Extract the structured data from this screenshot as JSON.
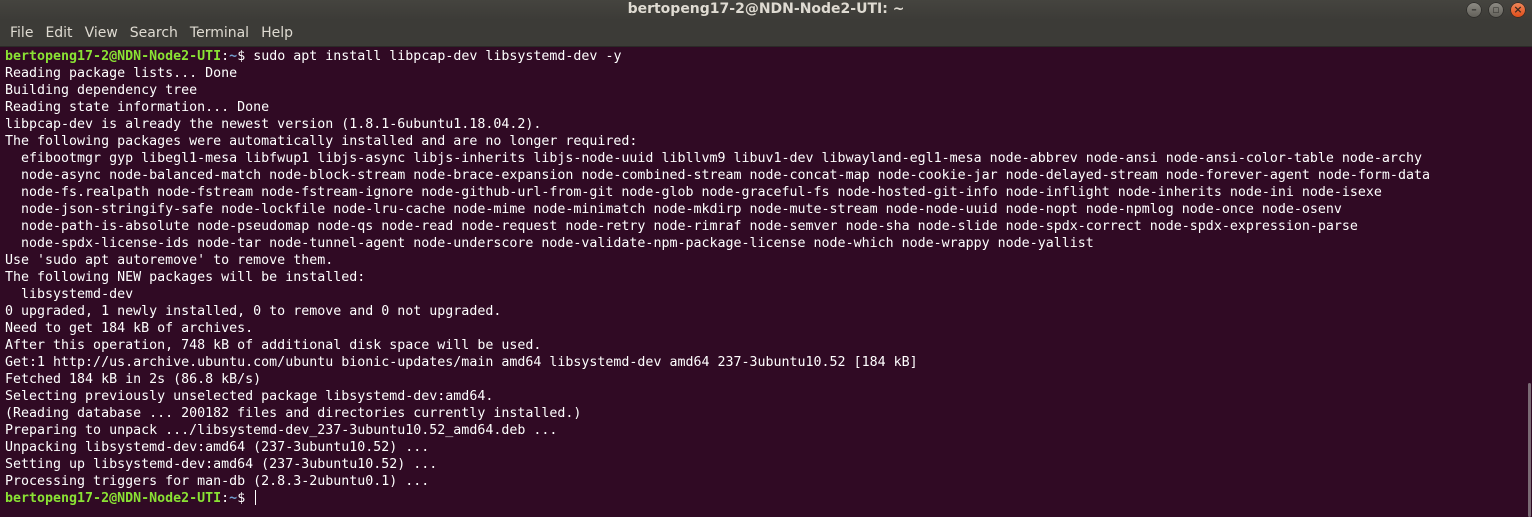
{
  "window": {
    "title": "bertopeng17-2@NDN-Node2-UTI: ~",
    "buttons": {
      "minimize": "–",
      "maximize": "▫",
      "close": "×"
    }
  },
  "menu": [
    "File",
    "Edit",
    "View",
    "Search",
    "Terminal",
    "Help"
  ],
  "prompt": {
    "user_host": "bertopeng17-2@NDN-Node2-UTI",
    "colon": ":",
    "path": "~",
    "symbol": "$ "
  },
  "command": "sudo apt install libpcap-dev libsystemd-dev -y",
  "output": [
    "Reading package lists... Done",
    "Building dependency tree",
    "Reading state information... Done",
    "libpcap-dev is already the newest version (1.8.1-6ubuntu1.18.04.2).",
    "The following packages were automatically installed and are no longer required:",
    "  efibootmgr gyp libegl1-mesa libfwup1 libjs-async libjs-inherits libjs-node-uuid libllvm9 libuv1-dev libwayland-egl1-mesa node-abbrev node-ansi node-ansi-color-table node-archy",
    "  node-async node-balanced-match node-block-stream node-brace-expansion node-combined-stream node-concat-map node-cookie-jar node-delayed-stream node-forever-agent node-form-data",
    "  node-fs.realpath node-fstream node-fstream-ignore node-github-url-from-git node-glob node-graceful-fs node-hosted-git-info node-inflight node-inherits node-ini node-isexe",
    "  node-json-stringify-safe node-lockfile node-lru-cache node-mime node-minimatch node-mkdirp node-mute-stream node-node-uuid node-nopt node-npmlog node-once node-osenv",
    "  node-path-is-absolute node-pseudomap node-qs node-read node-request node-retry node-rimraf node-semver node-sha node-slide node-spdx-correct node-spdx-expression-parse",
    "  node-spdx-license-ids node-tar node-tunnel-agent node-underscore node-validate-npm-package-license node-which node-wrappy node-yallist",
    "Use 'sudo apt autoremove' to remove them.",
    "The following NEW packages will be installed:",
    "  libsystemd-dev",
    "0 upgraded, 1 newly installed, 0 to remove and 0 not upgraded.",
    "Need to get 184 kB of archives.",
    "After this operation, 748 kB of additional disk space will be used.",
    "Get:1 http://us.archive.ubuntu.com/ubuntu bionic-updates/main amd64 libsystemd-dev amd64 237-3ubuntu10.52 [184 kB]",
    "Fetched 184 kB in 2s (86.8 kB/s)",
    "Selecting previously unselected package libsystemd-dev:amd64.",
    "(Reading database ... 200182 files and directories currently installed.)",
    "Preparing to unpack .../libsystemd-dev_237-3ubuntu10.52_amd64.deb ...",
    "Unpacking libsystemd-dev:amd64 (237-3ubuntu10.52) ...",
    "Setting up libsystemd-dev:amd64 (237-3ubuntu10.52) ...",
    "Processing triggers for man-db (2.8.3-2ubuntu0.1) ..."
  ],
  "colors": {
    "background": "#300a24",
    "prompt_user": "#8ae234",
    "prompt_path": "#729fcf",
    "text": "#ffffff"
  }
}
